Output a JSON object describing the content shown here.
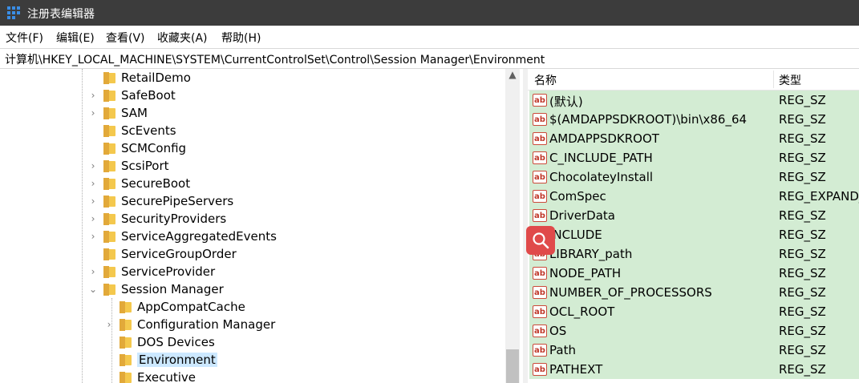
{
  "window": {
    "title": "注册表编辑器"
  },
  "menu": [
    "文件(F)",
    "编辑(E)",
    "查看(V)",
    "收藏夹(A)",
    "帮助(H)"
  ],
  "address": "计算机\\HKEY_LOCAL_MACHINE\\SYSTEM\\CurrentControlSet\\Control\\Session Manager\\Environment",
  "tree": [
    {
      "label": "RetailDemo",
      "expander": ""
    },
    {
      "label": "SafeBoot",
      "expander": ">"
    },
    {
      "label": "SAM",
      "expander": ">"
    },
    {
      "label": "ScEvents",
      "expander": ""
    },
    {
      "label": "SCMConfig",
      "expander": ""
    },
    {
      "label": "ScsiPort",
      "expander": ">"
    },
    {
      "label": "SecureBoot",
      "expander": ">"
    },
    {
      "label": "SecurePipeServers",
      "expander": ">"
    },
    {
      "label": "SecurityProviders",
      "expander": ">"
    },
    {
      "label": "ServiceAggregatedEvents",
      "expander": ">"
    },
    {
      "label": "ServiceGroupOrder",
      "expander": ""
    },
    {
      "label": "ServiceProvider",
      "expander": ">"
    },
    {
      "label": "Session Manager",
      "expander": "v"
    },
    {
      "label": "AppCompatCache",
      "expander": ""
    },
    {
      "label": "Configuration Manager",
      "expander": ">"
    },
    {
      "label": "DOS Devices",
      "expander": ""
    },
    {
      "label": "Environment",
      "expander": "",
      "selected": true
    },
    {
      "label": "Executive",
      "expander": ""
    }
  ],
  "list": {
    "columns": [
      "名称",
      "类型"
    ],
    "rows": [
      {
        "name": "(默认)",
        "type": "REG_SZ"
      },
      {
        "name": "$(AMDAPPSDKROOT)\\bin\\x86_64",
        "type": "REG_SZ"
      },
      {
        "name": "AMDAPPSDKROOT",
        "type": "REG_SZ"
      },
      {
        "name": "C_INCLUDE_PATH",
        "type": "REG_SZ"
      },
      {
        "name": "ChocolateyInstall",
        "type": "REG_SZ"
      },
      {
        "name": "ComSpec",
        "type": "REG_EXPAND_"
      },
      {
        "name": "DriverData",
        "type": "REG_SZ"
      },
      {
        "name": "INCLUDE",
        "type": "REG_SZ"
      },
      {
        "name": "LIBRARY_path",
        "type": "REG_SZ"
      },
      {
        "name": "NODE_PATH",
        "type": "REG_SZ"
      },
      {
        "name": "NUMBER_OF_PROCESSORS",
        "type": "REG_SZ"
      },
      {
        "name": "OCL_ROOT",
        "type": "REG_SZ"
      },
      {
        "name": "OS",
        "type": "REG_SZ"
      },
      {
        "name": "Path",
        "type": "REG_SZ"
      },
      {
        "name": "PATHEXT",
        "type": "REG_SZ"
      }
    ]
  },
  "icons": {
    "app": "registry-editor-icon",
    "value": "string-value-icon",
    "overlay": "magnifier-icon"
  },
  "colors": {
    "titlebar": "#3c3c3c",
    "row_highlight": "#d3ecd3",
    "selection": "#cce8ff",
    "folder": "#f4c84d",
    "overlay": "#e04a4a"
  }
}
